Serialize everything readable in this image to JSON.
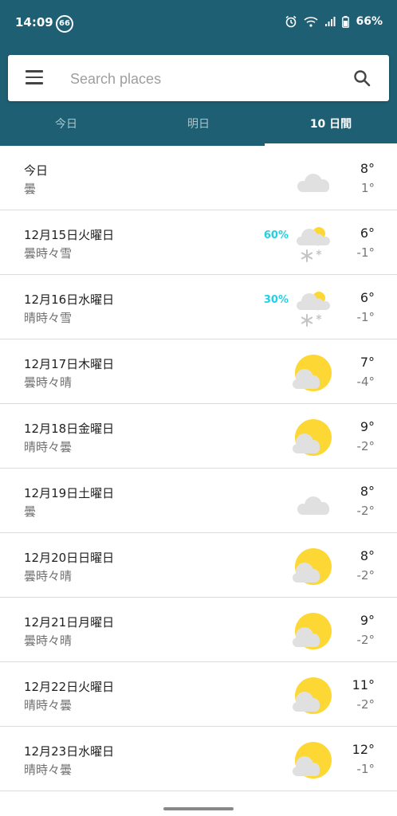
{
  "status": {
    "time": "14:09",
    "badge": "66",
    "battery": "66%"
  },
  "search": {
    "placeholder": "Search places"
  },
  "tabs": [
    {
      "label": "今日"
    },
    {
      "label": "明日"
    },
    {
      "label": "10 日間"
    }
  ],
  "forecast": [
    {
      "date": "今日",
      "condition": "曇",
      "hi": "8°",
      "lo": "1°",
      "precip": "",
      "icon": "cloudy-icon"
    },
    {
      "date": "12月15日火曜日",
      "condition": "曇時々雪",
      "hi": "6°",
      "lo": "-1°",
      "precip": "60%",
      "icon": "snow-icon"
    },
    {
      "date": "12月16日水曜日",
      "condition": "晴時々雪",
      "hi": "6°",
      "lo": "-1°",
      "precip": "30%",
      "icon": "snow-icon"
    },
    {
      "date": "12月17日木曜日",
      "condition": "曇時々晴",
      "hi": "7°",
      "lo": "-4°",
      "precip": "",
      "icon": "partly-cloudy-icon"
    },
    {
      "date": "12月18日金曜日",
      "condition": "晴時々曇",
      "hi": "9°",
      "lo": "-2°",
      "precip": "",
      "icon": "partly-cloudy-icon"
    },
    {
      "date": "12月19日土曜日",
      "condition": "曇",
      "hi": "8°",
      "lo": "-2°",
      "precip": "",
      "icon": "cloudy-icon"
    },
    {
      "date": "12月20日日曜日",
      "condition": "曇時々晴",
      "hi": "8°",
      "lo": "-2°",
      "precip": "",
      "icon": "partly-cloudy-icon"
    },
    {
      "date": "12月21日月曜日",
      "condition": "曇時々晴",
      "hi": "9°",
      "lo": "-2°",
      "precip": "",
      "icon": "partly-cloudy-icon"
    },
    {
      "date": "12月22日火曜日",
      "condition": "晴時々曇",
      "hi": "11°",
      "lo": "-2°",
      "precip": "",
      "icon": "partly-cloudy-icon"
    },
    {
      "date": "12月23日水曜日",
      "condition": "晴時々曇",
      "hi": "12°",
      "lo": "-1°",
      "precip": "",
      "icon": "partly-cloudy-icon"
    }
  ],
  "colors": {
    "header": "#1f5f73",
    "precip": "#21d1e3",
    "sun": "#fdd835",
    "cloud": "#e0e0e0"
  }
}
